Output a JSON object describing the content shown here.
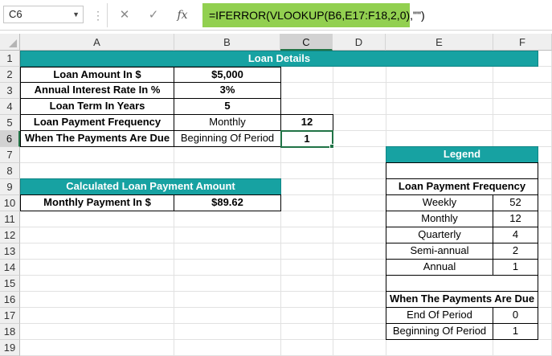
{
  "namebox": {
    "value": "C6"
  },
  "formula_bar": {
    "cancel_icon": "✕",
    "enter_icon": "✓",
    "fx_label": "fx",
    "formula": "=IFERROR(VLOOKUP(B6,E17:F18,2,0),\"\")"
  },
  "columns": [
    "A",
    "B",
    "C",
    "D",
    "E",
    "F"
  ],
  "rows": [
    "1",
    "2",
    "3",
    "4",
    "5",
    "6",
    "7",
    "8",
    "9",
    "10",
    "11",
    "12",
    "13",
    "14",
    "15",
    "16",
    "17",
    "18",
    "19"
  ],
  "loan_details": {
    "title": "Loan Details",
    "rows": [
      {
        "label": "Loan Amount In $",
        "value": "$5,000"
      },
      {
        "label": "Annual Interest Rate In %",
        "value": "3%"
      },
      {
        "label": "Loan Term In Years",
        "value": "5"
      },
      {
        "label": "Loan Payment Frequency",
        "value": "Monthly",
        "extra": "12"
      },
      {
        "label": "When The Payments Are Due",
        "value": "Beginning Of Period",
        "extra": "1"
      }
    ]
  },
  "calculated": {
    "title": "Calculated Loan Payment Amount",
    "label": "Monthly Payment In $",
    "value": "$89.62"
  },
  "legend": {
    "title": "Legend",
    "frequency_header": "Loan Payment Frequency",
    "frequency": [
      {
        "name": "Weekly",
        "value": "52"
      },
      {
        "name": "Monthly",
        "value": "12"
      },
      {
        "name": "Quarterly",
        "value": "4"
      },
      {
        "name": "Semi-annual",
        "value": "2"
      },
      {
        "name": "Annual",
        "value": "1"
      }
    ],
    "due_header": "When The Payments Are Due",
    "due": [
      {
        "name": "End Of Period",
        "value": "0"
      },
      {
        "name": "Beginning Of Period",
        "value": "1"
      }
    ]
  },
  "colors": {
    "header_teal": "#17a2a2",
    "formula_highlight": "#92d050",
    "selection_green": "#217346"
  }
}
